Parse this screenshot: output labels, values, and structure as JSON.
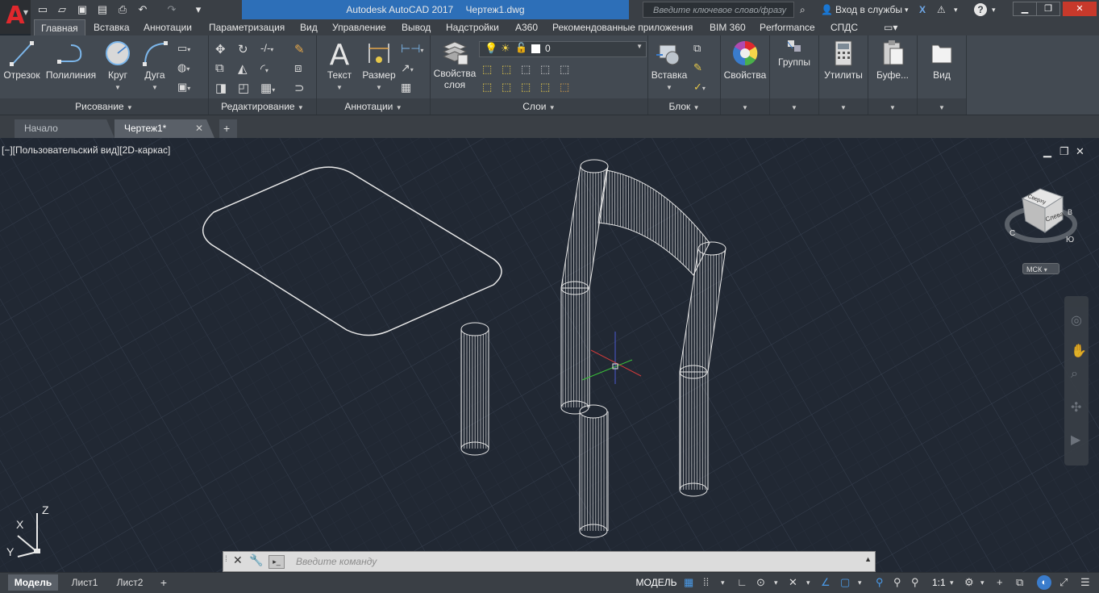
{
  "titlebar": {
    "app_title": "Autodesk AutoCAD 2017",
    "file_title": "Чертеж1.dwg",
    "search_placeholder": "Введите ключевое слово/фразу",
    "signin_label": "Вход в службы",
    "help_label": "?"
  },
  "ribbon_tabs": [
    "Главная",
    "Вставка",
    "Аннотации",
    "Параметризация",
    "Вид",
    "Управление",
    "Вывод",
    "Надстройки",
    "A360",
    "Рекомендованные приложения",
    "BIM 360",
    "Performance",
    "СПДС"
  ],
  "panels": {
    "draw": {
      "title": "Рисование",
      "line": "Отрезок",
      "polyline": "Полилиния",
      "circle": "Круг",
      "arc": "Дуга"
    },
    "modify": {
      "title": "Редактирование"
    },
    "annotation": {
      "title": "Аннотации",
      "text": "Текст",
      "dimension": "Размер"
    },
    "layers": {
      "title": "Слои",
      "properties": "Свойства слоя",
      "current_layer": "0"
    },
    "block": {
      "title": "Блок",
      "insert": "Вставка"
    },
    "properties": {
      "label": "Свойства"
    },
    "groups": {
      "label": "Группы"
    },
    "utilities": {
      "label": "Утилиты"
    },
    "clipboard": {
      "label": "Буфе..."
    },
    "view": {
      "label": "Вид"
    }
  },
  "file_tabs": {
    "start": "Начало",
    "drawing": "Чертеж1*"
  },
  "viewport": {
    "label": "[−][Пользовательский вид][2D-каркас]",
    "wcs_label": "МСК",
    "viewcube_face_top": "Сверху",
    "viewcube_face_left": "Слева",
    "ucs_z": "Z",
    "ucs_x": "X",
    "ucs_y": "Y"
  },
  "command_line": {
    "placeholder": "Введите команду"
  },
  "layout_tabs": [
    "Модель",
    "Лист1",
    "Лист2"
  ],
  "statusbar": {
    "model_label": "МОДЕЛЬ",
    "scale": "1:1"
  },
  "colors": {
    "accent_blue": "#2d6fb8",
    "autocad_red": "#e0282d",
    "viewport_bg": "#212833",
    "wire": "#e8e8e8"
  }
}
